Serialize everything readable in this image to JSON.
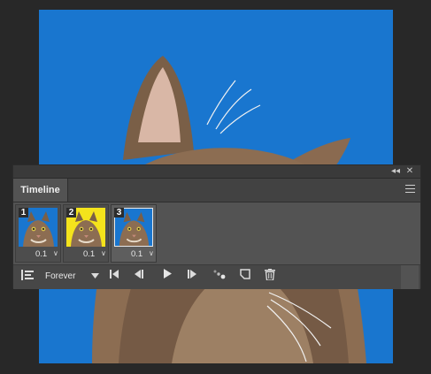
{
  "panel": {
    "tab_title": "Timeline",
    "collapse_glyph": "◂◂",
    "close_glyph": "✕",
    "menu_icon": "hamburger-menu-icon"
  },
  "frames": [
    {
      "number": "1",
      "delay": "0.1",
      "background": "#1976cf"
    },
    {
      "number": "2",
      "delay": "0.1",
      "background": "#f4e31c"
    },
    {
      "number": "3",
      "delay": "0.1",
      "background": "#1976cf"
    }
  ],
  "selected_frame": 3,
  "controls": {
    "loop_value": "Forever",
    "icons": [
      "convert-timeline-icon",
      "first-frame-icon",
      "previous-frame-icon",
      "play-icon",
      "next-frame-icon",
      "tween-icon",
      "duplicate-frame-icon",
      "trash-icon"
    ]
  },
  "colors": {
    "sky_blue": "#1976cf",
    "highlight_yellow": "#f4e31c",
    "panel_bg": "#535353",
    "app_bg": "#282828"
  }
}
